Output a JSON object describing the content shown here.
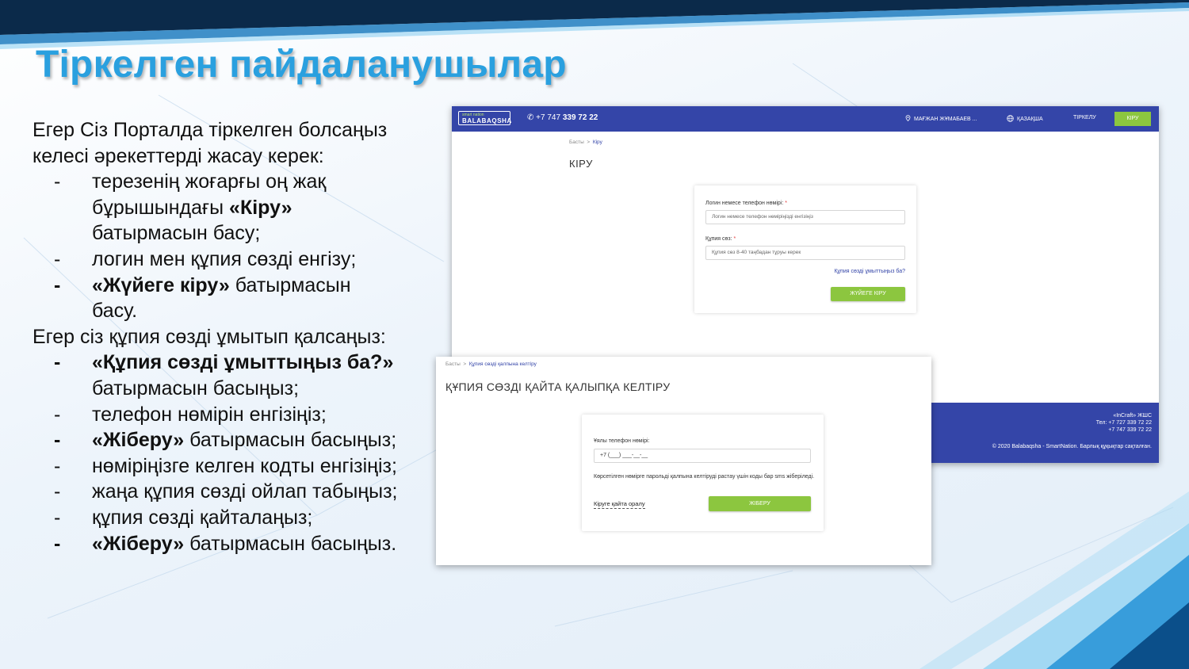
{
  "slide": {
    "title": "Тіркелген пайдаланушылар",
    "intro": [
      "Егер Сіз Порталда тіркелген болсаңыз",
      "келесі әрекеттерді жасау керек:"
    ],
    "steps_login": [
      {
        "dash": "-",
        "bold": false,
        "lines": [
          {
            "pre": "терезенің жоғарғы оң жақ",
            "b": "",
            "post": ""
          },
          {
            "pre": "бұрышындағы ",
            "b": "«Кіру»",
            "post": ""
          },
          {
            "pre": "батырмасын басу;",
            "b": "",
            "post": ""
          }
        ]
      },
      {
        "dash": "-",
        "bold": false,
        "lines": [
          {
            "pre": "логин мен құпия сөзді енгізу;",
            "b": "",
            "post": ""
          }
        ]
      },
      {
        "dash": "-",
        "bold": true,
        "lines": [
          {
            "pre": "",
            "b": "«Жүйеге кіру»",
            "post": " батырмасын"
          },
          {
            "pre": "басу.",
            "b": "",
            "post": ""
          }
        ]
      }
    ],
    "forgot_intro": "Егер сіз құпия сөзді ұмытып қалсаңыз:",
    "steps_forgot": [
      {
        "dash": "-",
        "bold": true,
        "lines": [
          {
            "pre": "",
            "b": "«Құпия сөзді ұмыттыңыз ба?»",
            "post": ""
          },
          {
            "pre": "батырмасын басыңыз;",
            "b": "",
            "post": ""
          }
        ]
      },
      {
        "dash": "-",
        "bold": false,
        "lines": [
          {
            "pre": "телефон нөмірін енгізіңіз;",
            "b": "",
            "post": ""
          }
        ]
      },
      {
        "dash": "-",
        "bold": true,
        "lines": [
          {
            "pre": "",
            "b": "«Жіберу»",
            "post": " батырмасын басыңыз;"
          }
        ]
      },
      {
        "dash": "-",
        "bold": false,
        "lines": [
          {
            "pre": "нөміріңізге келген кодты енгізіңіз;",
            "b": "",
            "post": ""
          }
        ]
      },
      {
        "dash": "-",
        "bold": false,
        "lines": [
          {
            "pre": "жаңа құпия сөзді ойлап табыңыз;",
            "b": "",
            "post": ""
          }
        ]
      },
      {
        "dash": "-",
        "bold": false,
        "lines": [
          {
            "pre": "құпия сөзді қайталаңыз;",
            "b": "",
            "post": ""
          }
        ]
      },
      {
        "dash": "-",
        "bold": true,
        "lines": [
          {
            "pre": "",
            "b": "«Жіберу»",
            "post": " батырмасын басыңыз."
          }
        ]
      }
    ]
  },
  "login_shot": {
    "logo_top": "smart nation",
    "logo_main": "BALABAQSHA",
    "phone_prefix": "+7 747 ",
    "phone_main": "339 72 22",
    "user": "МАҒЖАН ЖҰМАБАЕВ ...",
    "language": "ҚАЗАҚША",
    "register": "ТІРКЕЛУ",
    "login_button": "КІРУ",
    "crumb_home": "Басты",
    "crumb_sep": ">",
    "crumb_current": "Кіру",
    "heading": "КІРУ",
    "login_label": "Логин немесе телефон нөмірі: ",
    "login_placeholder": "Логин немесе телефон нөміріңізді енгізіңіз",
    "password_label": "Құпия сөз: ",
    "password_placeholder": "Құпия сөз 8-40 таңбадан тұруы керек",
    "required_mark": "*",
    "forgot_link": "Құпия сөзді ұмыттыңыз ба?",
    "submit_button": "ЖҮЙЕГЕ КІРУ",
    "footer_company": "«InCraft» ЖШС",
    "footer_tel1": "Тел: +7 727 339 72 22",
    "footer_tel2": "+7 747 339 72 22",
    "footer_copyright": "© 2020 Balabaqsha - SmartNation. Барлық құқықтар сақталған."
  },
  "reset_shot": {
    "crumb_home": "Басты",
    "crumb_sep": ">",
    "crumb_current": "Құпия сөзді қалпына келтіру",
    "heading": "ҚҰПИЯ СӨЗДІ ҚАЙТА ҚАЛЫПҚА КЕЛТІРУ",
    "phone_label": "Ұялы телефон нөмірі:",
    "phone_value": "+7 (___) ___-__-__",
    "note": "Көрсетілген нөмірге парольді қалпына келтіруді растау үшін коды бар sms жіберіледі.",
    "back_link": "Кіруге қайта оралу",
    "send_button": "ЖІБЕРУ"
  },
  "colors": {
    "title": "#2aa0df",
    "portal_blue": "#3445a8",
    "green": "#8cc63f"
  }
}
